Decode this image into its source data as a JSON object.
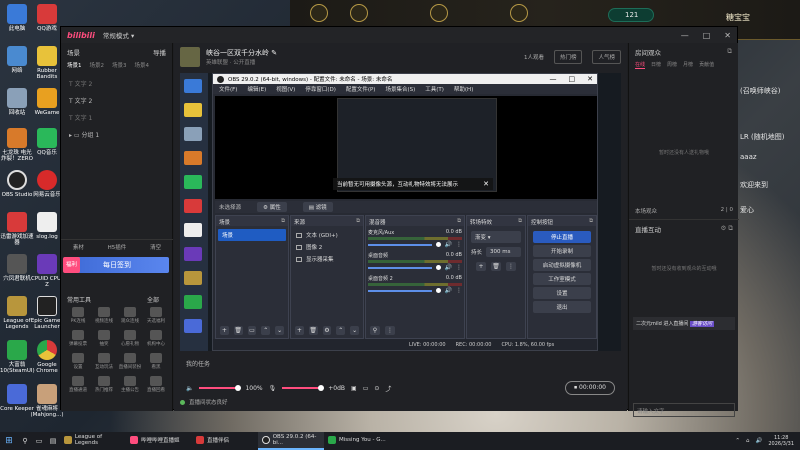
{
  "desktop": {
    "icons_left": [
      "此电脑",
      "网络",
      "回收站",
      "七龙珠 电光 炸裂！ZERO",
      "OBS Studio",
      "迅雷游戏加速器",
      "穴凤君联机",
      "League of Legends",
      "大富翁10(SteamUI)",
      "Core Keeper"
    ],
    "icons_col2": [
      "QQ游戏",
      "Rubber Bandits",
      "WeGame",
      "QQ音乐",
      "网易云音乐",
      "slog.log",
      "CPUID CPU-Z",
      "Epic Games Launcher",
      "Google Chrome",
      "雀魂麻将(Mahjong...)"
    ],
    "side_texts": [
      "(召唤师峡谷)",
      "LR (随机地图)",
      "aaaz",
      "欢迎来到",
      "爱心"
    ],
    "banner": {
      "badge_value": "121",
      "player_name": "糖宝宝"
    }
  },
  "app": {
    "logo": "bilibili",
    "mode_label": "常规模式",
    "left": {
      "scene_label": "场景",
      "import_label": "导播",
      "tabs": [
        "场景1",
        "场景2",
        "场景3",
        "场景4"
      ],
      "items": [
        "文字 2",
        "文字 2",
        "文字 1"
      ],
      "group_label": "分组 1",
      "bottom_actions": [
        "素材",
        "H5插件",
        "清空"
      ],
      "sign_tag": "福利",
      "sign_label": "每日签到",
      "tools_label": "常用工具",
      "tools_more": "全部",
      "tools": [
        "PK连线",
        "视频连线",
        "观众连线",
        "天选福利",
        "弹幕投票",
        "抽奖",
        "心愿礼物",
        "机构中心",
        "设置",
        "互动玩法",
        "直播间装扮",
        "看黑",
        "直播通道",
        "热门推荐",
        "主播公告",
        "直播回看"
      ]
    },
    "room": {
      "title": "峡谷一区双千分水岭",
      "sub_category": "英雄联盟",
      "sub_visibility": "公开直播",
      "viewer_count": "1人观看",
      "btn_hot": "热门榜",
      "btn_popular": "人气榜"
    },
    "obs": {
      "title": "OBS 29.0.2 (64-bit, windows) - 配置文件: 未命名 - 场景: 未命名",
      "menu": [
        "文件(F)",
        "编辑(E)",
        "视图(V)",
        "停靠窗口(D)",
        "配置文件(P)",
        "场景集合(S)",
        "工具(T)",
        "帮助(H)"
      ],
      "toast": "当前暂无可用摄像头源，互动礼物特效将无法展示",
      "no_source": "未选择源",
      "props_label": "属性",
      "filters_label": "滤镜",
      "docks": {
        "scenes": {
          "title": "场景",
          "items": [
            "场景"
          ]
        },
        "sources": {
          "title": "来源",
          "items": [
            "文本 (GDI+)",
            "图像 2",
            "显示器采集"
          ]
        },
        "mixer": {
          "title": "混音器",
          "channels": [
            {
              "name": "麦克风/Aux",
              "db": "0.0 dB"
            },
            {
              "name": "桌面音频",
              "db": "0.0 dB"
            },
            {
              "name": "桌面音频 2",
              "db": "0.0 dB"
            }
          ]
        },
        "transitions": {
          "title": "转场特效",
          "type": "渐变",
          "duration_label": "持长",
          "duration": "300 ms"
        },
        "controls": {
          "title": "控制按钮",
          "buttons": [
            "停止直播",
            "开始录制",
            "启动虚拟摄像机",
            "工作室模式",
            "设置",
            "退出"
          ]
        }
      },
      "status": {
        "live": "LIVE: 00:00:00",
        "rec": "REC: 00:00:00",
        "cpu": "CPU: 1.8%, 60.00 fps"
      }
    },
    "bottom": {
      "task_note": "我的任务",
      "volume": "100%",
      "mic_db": "+0dB",
      "stop_label": "00:00:00",
      "live_status": "直播间状态良好"
    },
    "right": {
      "title": "房间观众",
      "tabs": [
        "在线",
        "日榜",
        "周榜",
        "月榜",
        "贡献值"
      ],
      "empty_text": "暂时还没有人送礼物哦",
      "online_label": "本场观众",
      "online_values": [
        "2",
        "0"
      ],
      "interact_title": "直播互动",
      "interact_empty": "暂时还没有收到观众的互动哦",
      "chat_user": "二次元mild",
      "chat_text": "进入直播间",
      "chat_badge": "游客访问",
      "input_placeholder": "请输入文字"
    }
  },
  "taskbar": {
    "apps": [
      "League of Legends",
      "哔哩哔哩直播姬",
      "直播伴侣",
      "OBS 29.0.2 (64-bi...",
      "Missing You - G..."
    ],
    "time": "11:28",
    "date": "2026/3/31"
  }
}
